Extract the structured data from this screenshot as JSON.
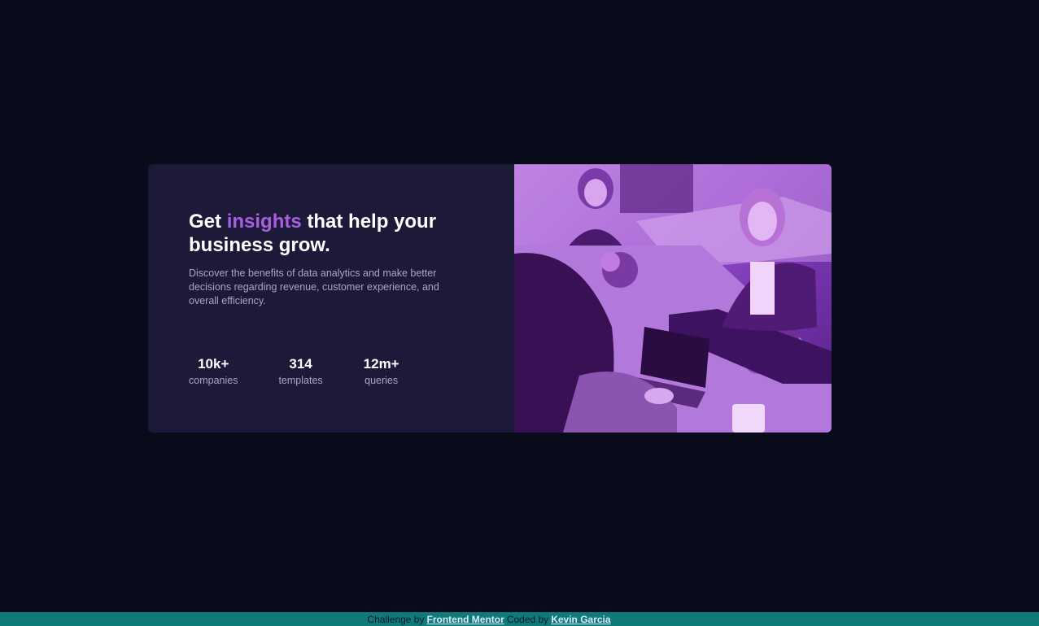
{
  "card": {
    "headline": {
      "before": "Get ",
      "accent": "insights",
      "after": " that help your business grow."
    },
    "description": "Discover the benefits of data analytics and make better decisions regarding revenue, customer experience, and overall efficiency.",
    "stats": [
      {
        "value": "10k+",
        "label": "companies"
      },
      {
        "value": "314",
        "label": "templates"
      },
      {
        "value": "12m+",
        "label": "queries"
      }
    ]
  },
  "footer": {
    "prefix": "Challenge by",
    "challenge_link": "Frontend Mentor",
    "middle": "Coded by",
    "author_link": "Kevin Garcia"
  },
  "colors": {
    "page_bg": "#090b1a",
    "card_bg": "#1c1a38",
    "accent": "#a95ee0",
    "image_overlay": "#aa5cdb",
    "footer_bg": "#0f7a7a"
  }
}
